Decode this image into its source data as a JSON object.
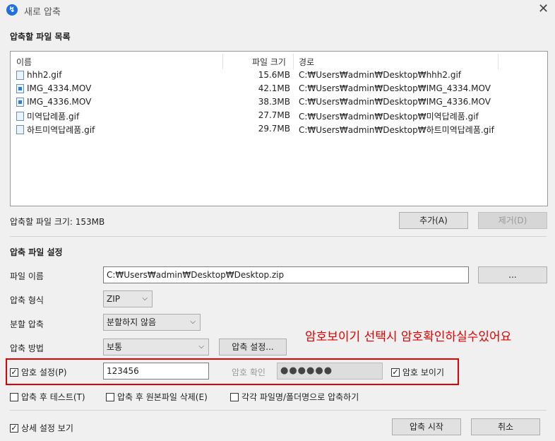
{
  "window": {
    "title": "새로 압축",
    "close_glyph": "✕",
    "app_icon_glyph": "↯"
  },
  "file_list": {
    "section_title": "압축할 파일 목록",
    "columns": {
      "name": "이름",
      "size": "파일 크기",
      "path": "경로"
    },
    "rows": [
      {
        "name": "hhh2.gif",
        "size": "15.6MB",
        "path": "C:₩Users₩admin₩Desktop₩hhh2.gif",
        "type": "gif"
      },
      {
        "name": "IMG_4334.MOV",
        "size": "42.1MB",
        "path": "C:₩Users₩admin₩Desktop₩IMG_4334.MOV",
        "type": "mov"
      },
      {
        "name": "IMG_4336.MOV",
        "size": "38.3MB",
        "path": "C:₩Users₩admin₩Desktop₩IMG_4336.MOV",
        "type": "mov"
      },
      {
        "name": "미역답례품.gif",
        "size": "27.7MB",
        "path": "C:₩Users₩admin₩Desktop₩미역답례품.gif",
        "type": "gif"
      },
      {
        "name": "하트미역답례품.gif",
        "size": "29.7MB",
        "path": "C:₩Users₩admin₩Desktop₩하트미역답례품.gif",
        "type": "gif"
      }
    ],
    "total_size": "압축할 파일 크기: 153MB",
    "add_label": "추가(A)",
    "remove_label": "제거(D)"
  },
  "settings": {
    "section_title": "압축 파일 설정",
    "file_name_label": "파일 이름",
    "file_name_value": "C:₩Users₩admin₩Desktop₩Desktop.zip",
    "browse_label": "...",
    "format_label": "압축 형식",
    "format_value": "ZIP",
    "split_label": "분할 압축",
    "split_value": "분할하지 않음",
    "method_label": "압축 방법",
    "method_value": "보통",
    "method_settings_label": "압축 설정...",
    "password_label": "암호 설정(P)",
    "password_value": "123456",
    "password_confirm_label": "암호 확인",
    "password_confirm_value": "●●●●●●",
    "show_password_label": "암호 보이기",
    "test_after_label": "압축 후 테스트(T)",
    "delete_original_label": "압축 후 원본파일 삭제(E)",
    "each_folder_label": "각각 파일명/폴더명으로 압축하기",
    "detail_view_label": "상세 설정 보기",
    "start_label": "압축 시작",
    "cancel_label": "취소"
  },
  "annotation": "암호보이기 선택시 암호확인하실수있어요",
  "checkmark": "✓",
  "arrow_down": "⌵"
}
